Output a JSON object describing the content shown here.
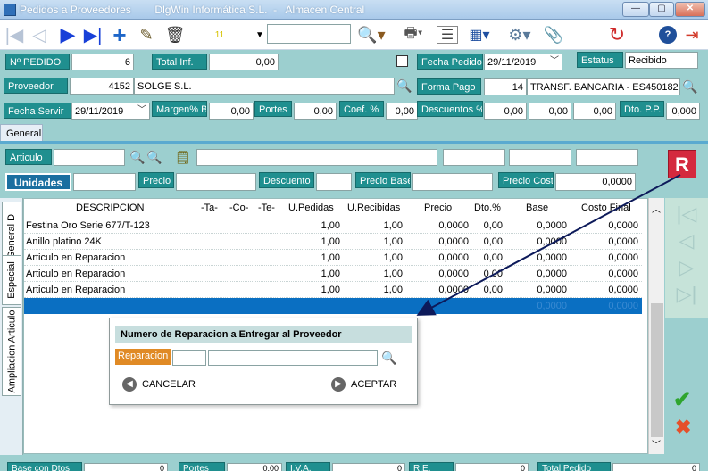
{
  "window": {
    "title": "Pedidos a Proveedores        DlgWin Informática S.L.  -   Almacen Central",
    "minimize": "—",
    "maximize": "▢",
    "close": "✕"
  },
  "toolbar": {
    "counter": "11",
    "search_value": "",
    "icons": [
      "first-icon",
      "prev-icon",
      "next-icon",
      "last-icon",
      "add-icon",
      "edit-icon",
      "delete-icon",
      "search-icon",
      "print-icon",
      "list-icon",
      "table-icon",
      "settings-icon",
      "attach-icon",
      "refresh-icon",
      "help-icon",
      "exit-icon"
    ]
  },
  "header": {
    "pedido_label": "Nº PEDIDO",
    "pedido_value": "6",
    "total_inf_label": "Total Inf.",
    "total_inf_value": "0,00",
    "fecha_pedido_label": "Fecha Pedido",
    "fecha_pedido_value": "29/11/2019",
    "estatus_label": "Estatus",
    "estatus_value": "Recibido",
    "proveedor_label": "Proveedor",
    "proveedor_code": "4152",
    "proveedor_name": "SOLGE S.L.",
    "forma_pago_label": "Forma Pago",
    "forma_pago_code": "14",
    "forma_pago_name": "TRANSF. BANCARIA - ES450182",
    "fecha_servir_label": "Fecha Servir",
    "fecha_servir_value": "29/11/2019",
    "margen_label": "Margen% B",
    "margen_value": "0,00",
    "portes_label": "Portes",
    "portes_value": "0,00",
    "coef_label": "Coef. %",
    "coef_value": "0,00",
    "descuentos_label": "Descuentos %",
    "desc1": "0,00",
    "desc2": "0,00",
    "desc3": "0,00",
    "dto_pp_label": "Dto. P.P.",
    "dto_pp_value": "0,000"
  },
  "tabs": {
    "general": "General"
  },
  "entry": {
    "articulo_label": "Articulo",
    "unidades_label": "Unidades",
    "precio_label": "Precio",
    "descuento_label": "Descuento",
    "precio_base_label": "Precio Base",
    "precio_coste_label": "Precio Coste",
    "precio_coste_value": "0,0000",
    "r_button": "R"
  },
  "side_tabs": {
    "general_d": "General D",
    "especial": "Especial",
    "ampliacion": "Ampliacion Articulo"
  },
  "grid": {
    "columns": [
      "DESCRIPCION",
      "-Ta-",
      "-Co-",
      "-Te-",
      "U.Pedidas",
      "U.Recibidas",
      "Precio",
      "Dto.%",
      "Base",
      "Costo Final"
    ],
    "rows": [
      [
        "Festina Oro Serie 677/T-123",
        "",
        "",
        "",
        "1,00",
        "1,00",
        "0,0000",
        "0,00",
        "0,0000",
        "0,0000"
      ],
      [
        "Anillo platino 24K",
        "",
        "",
        "",
        "1,00",
        "1,00",
        "0,0000",
        "0,00",
        "0,0000",
        "0,0000"
      ],
      [
        "Articulo en Reparacion",
        "",
        "",
        "",
        "1,00",
        "1,00",
        "0,0000",
        "0,00",
        "0,0000",
        "0,0000"
      ],
      [
        "Articulo en Reparacion",
        "",
        "",
        "",
        "1,00",
        "1,00",
        "0,0000",
        "0,00",
        "0,0000",
        "0,0000"
      ],
      [
        "Articulo en Reparacion",
        "",
        "",
        "",
        "1,00",
        "1,00",
        "0,0000",
        "0,00",
        "0,0000",
        "0,0000"
      ]
    ],
    "selected_row_base": "0,0000",
    "selected_row_costo": "0,0000"
  },
  "dialog": {
    "title": "Numero de Reparacion a Entregar al Proveedor",
    "reparacion_label": "Reparacion",
    "reparacion_code": "",
    "reparacion_value": "",
    "cancel_label": "CANCELAR",
    "accept_label": "ACEPTAR"
  },
  "footer": {
    "base_dtos_label": "Base con Dtos",
    "base_dtos_value": "0",
    "portes_label": "Portes",
    "portes_value": "0,00",
    "iva_label": "I.V.A.",
    "iva_value": "0",
    "re_label": "R.E.",
    "re_value": "0",
    "total_label": "Total Pedido",
    "total_value": "0"
  },
  "colors": {
    "label_bg": "#1f8f8f",
    "panel_bg": "#9ccfcf",
    "selected_row": "#0a6fc2",
    "r_button": "#d4293e",
    "orange_label": "#e08a25"
  }
}
